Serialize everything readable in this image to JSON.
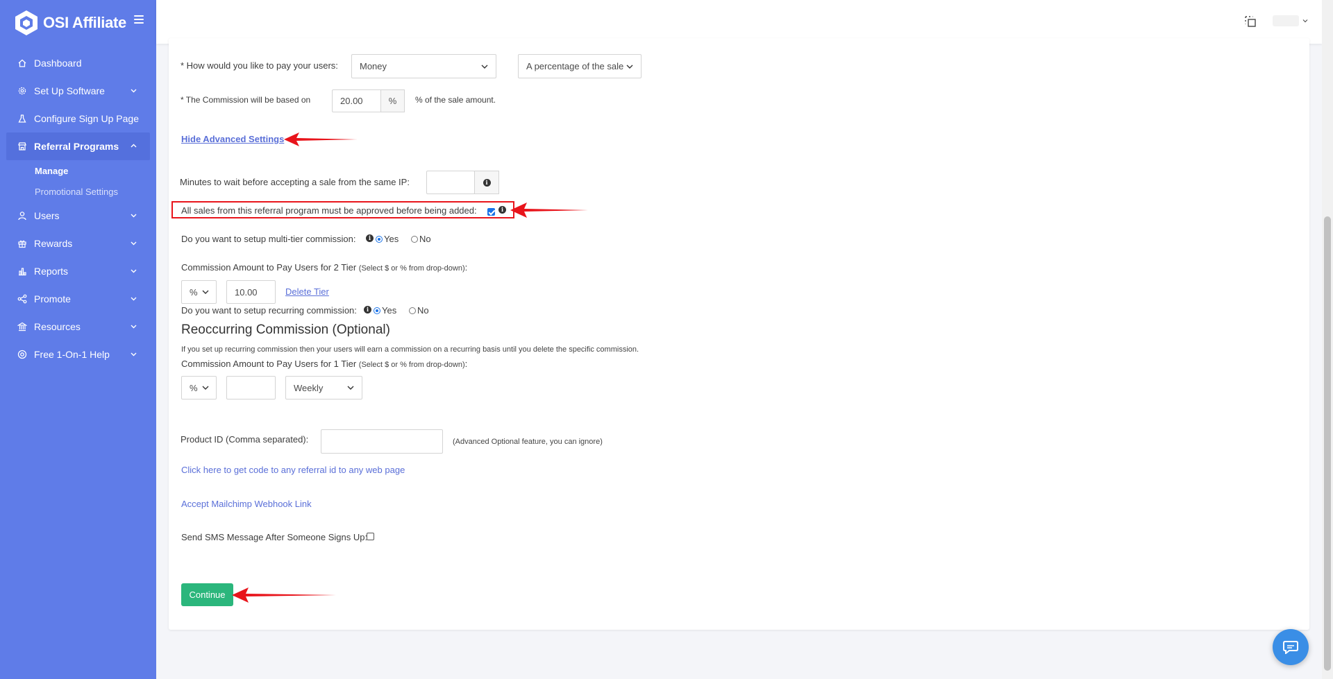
{
  "brand": {
    "name": "OSI Affiliate"
  },
  "sidebar": {
    "items": [
      {
        "label": "Dashboard",
        "icon": "home-icon"
      },
      {
        "label": "Set Up Software",
        "icon": "gear-icon"
      },
      {
        "label": "Configure Sign Up Page",
        "icon": "flask-icon"
      },
      {
        "label": "Referral Programs",
        "icon": "store-icon"
      },
      {
        "label": "Users",
        "icon": "user-icon"
      },
      {
        "label": "Rewards",
        "icon": "gift-icon"
      },
      {
        "label": "Reports",
        "icon": "bar-chart-icon"
      },
      {
        "label": "Promote",
        "icon": "share-icon"
      },
      {
        "label": "Resources",
        "icon": "bank-icon"
      },
      {
        "label": "Free 1-On-1 Help",
        "icon": "lifebuoy-icon"
      }
    ],
    "submenu": [
      {
        "label": "Manage"
      },
      {
        "label": "Promotional Settings"
      }
    ]
  },
  "form": {
    "pay_label": "* How would you like to pay your users:",
    "pay_method": "Money",
    "pay_type": "A percentage of the sale",
    "commission_label": "* The Commission will be based on",
    "commission_value": "20.00",
    "commission_unit": "%",
    "commission_suffix": "% of the sale amount.",
    "advanced_link": "Hide Advanced Settings",
    "minutes_label": "Minutes to wait before accepting a sale from the same IP:",
    "minutes_value": "",
    "approve_label": "All sales from this referral program must be approved before being added:",
    "multitier_label": "Do you want to setup multi-tier commission:",
    "yes": "Yes",
    "no": "No",
    "tier2_label": "Commission Amount to Pay Users for 2 Tier",
    "tier_hint": "(Select $ or % from drop-down)",
    "colon": ":",
    "tier2_unit": "%",
    "tier2_value": "10.00",
    "delete_tier": "Delete Tier",
    "recurring_label": "Do you want to setup recurring commission:",
    "recurring_heading": "Reoccurring Commission (Optional)",
    "recurring_desc": "If you set up recurring commission then your users will earn a commission on a recurring basis until you delete the specific commission.",
    "tier1_label": "Commission Amount to Pay Users for 1 Tier",
    "tier1_unit": "%",
    "tier1_value": "",
    "frequency": "Weekly",
    "product_label": "Product ID (Comma separated):",
    "product_value": "",
    "product_hint": "(Advanced Optional feature, you can ignore)",
    "code_link": "Click here to get code to any referral id to any web page",
    "mailchimp_link": "Accept Mailchimp Webhook Link",
    "sms_label": "Send SMS Message After Someone Signs Up:",
    "continue": "Continue"
  },
  "colors": {
    "sidebar": "#5f7ce8",
    "accent_green": "#2bb67c",
    "link": "#5a6fd8",
    "annotation_red": "#e8141b"
  }
}
